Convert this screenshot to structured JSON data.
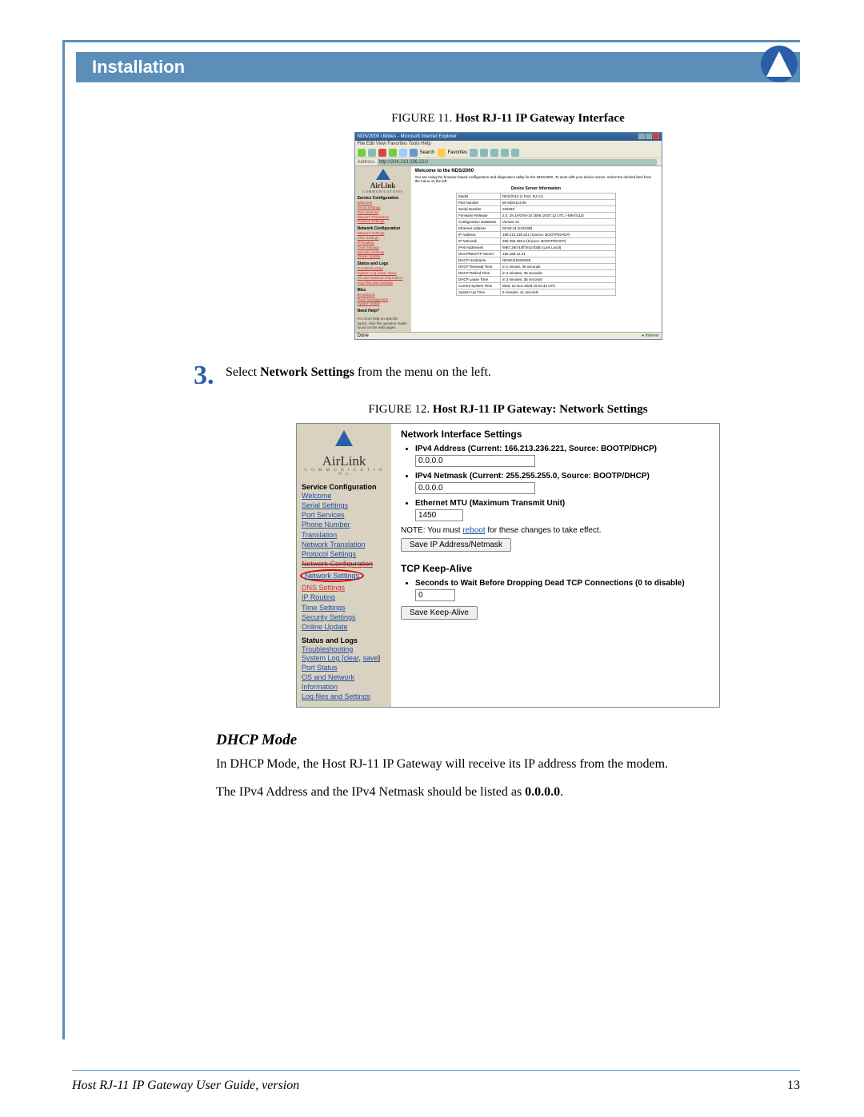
{
  "header": {
    "section": "Installation"
  },
  "fig11": {
    "caption_label": "FIGURE 11.  ",
    "caption_title": "Host RJ-11 IP Gateway Interface",
    "ie": {
      "title": "NDS/2000 Utilities - Microsoft Internet Explorer",
      "menubar": "File  Edit  View  Favorites  Tools  Help",
      "toolbar_search": "Search",
      "toolbar_fav": "Favorites",
      "addr_label": "Address",
      "addr_value": "http://204.213.236.221/",
      "welcome": "Welcome to the NDS/2000",
      "welcome_sub": "You are using the browser-based configuration and diagnostics utility for the NDS/2000. To work with your device server, select the desired item from the menu on the left.",
      "table_heading": "Device Server Information",
      "rows": [
        [
          "Model",
          "NDS/2110 (1 Port, RJ-11)"
        ],
        [
          "Part Number",
          "80-NDS114-00"
        ],
        [
          "Serial Number",
          "019333"
        ],
        [
          "Firmware Release",
          "2.0, 28 JAN'SN-10 2006 19:07:12 UTC (-MN-0113)"
        ],
        [
          "Configuration Database",
          "Version 21"
        ],
        [
          "Ethernet Address",
          "00:60:44:10:83:BB"
        ],
        [
          "IP Address",
          "169.213.236.221 (Source: BOOTP/DHCP)"
        ],
        [
          "IP Netmask",
          "255.255.255.0 (Source: BOOTP/DHCP)"
        ],
        [
          "IPv6 Addresses",
          "fe80::260:44ff:fe10:83bb (Link Local)"
        ],
        [
          "DHCP/BOOTP Server",
          "192.168.12.21"
        ],
        [
          "DHCP Hostname",
          "NDS0119333G88"
        ],
        [
          "DHCP Renewal Time",
          "in 1 minute, 36 seconds"
        ],
        [
          "DHCP Rebind Time",
          "in 2 minutes, 35 seconds"
        ],
        [
          "DHCP Lease Time",
          "in 3 minutes, 35 seconds"
        ],
        [
          "Current System Time",
          "Wed, 22 Nov 2006 19:23:42 UTC"
        ],
        [
          "System Up Time",
          "5 minutes, 41 seconds"
        ]
      ],
      "sidebar": {
        "g1_h": "Service Configuration",
        "g1": [
          "Welcome",
          "Serial Settings",
          "Port Services",
          "Network Translation",
          "Protocol Settings"
        ],
        "g2_h": "Network Configuration",
        "g2": [
          "Network Settings",
          "DNS Settings",
          "IP Routing",
          "Time Settings",
          "Security Settings",
          "Online Update"
        ],
        "g3_h": "Status and Logs",
        "g3": [
          "Troubleshooting",
          "System Log [clear, save]",
          "OS and Network Information",
          "Log Files and Settings"
        ],
        "g4_h": "Misc",
        "g4": [
          "Broadband",
          "Flash Management",
          "System Install"
        ],
        "help_h": "Need Help?",
        "help": "For more help on specific topics, click the question marks found on the web pages.",
        "done": "Done",
        "internet": "Internet"
      }
    }
  },
  "step3": {
    "num": "3.",
    "text_pre": "Select ",
    "text_bold": "Network Settings",
    "text_post": " from the menu on the left."
  },
  "fig12": {
    "caption_label": "FIGURE 12.  ",
    "caption_title": "Host RJ-11 IP Gateway:  Network Settings",
    "sidebar": {
      "logo": "AirLink",
      "logo_sub": "C O M M U N I C A T I O N S",
      "g1_h": "Service Configuration",
      "g1": [
        "Welcome",
        "Serial Settings",
        "Port Services",
        "Phone Number Translation",
        "Network Translation",
        "Protocol Settings"
      ],
      "strike": "Network Configuration",
      "oval": "Network Settings",
      "red_items": [
        "DNS Settings",
        "IP Routing",
        "Time Settings",
        "Security Settings",
        "Online Update"
      ],
      "g3_h": "Status and Logs",
      "g3_a": "Troubleshooting",
      "g3_b_pre": "System Log  [",
      "g3_b_clear": "clear",
      "g3_b_sep": ",  ",
      "g3_b_save": "save",
      "g3_b_post": "]",
      "g3_c": "Port Status",
      "g3_d": "OS and Network Information",
      "g3_e": "Log files and Settings"
    },
    "main": {
      "h1": "Network Interface Settings",
      "li1": "IPv4 Address (Current: 166.213.236.221, Source: BOOTP/DHCP)",
      "v1": "0.0.0.0",
      "li2": "IPv4 Netmask (Current: 255.255.255.0, Source: BOOTP/DHCP)",
      "v2": "0.0.0.0",
      "li3": "Ethernet MTU (Maximum Transmit Unit)",
      "v3": "1450",
      "note_pre": "NOTE: You must ",
      "note_link": "reboot",
      "note_post": " for these changes to take effect.",
      "btn1": "Save IP Address/Netmask",
      "h2": "TCP Keep-Alive",
      "li4": "Seconds to Wait Before Dropping Dead TCP Connections (0 to disable)",
      "v4": "0",
      "btn2": "Save Keep-Alive"
    }
  },
  "body": {
    "h3": "DHCP Mode",
    "p1": "In DHCP Mode, the Host RJ-11 IP Gateway will receive its IP address from the modem.",
    "p2_pre": "The IPv4 Address and the IPv4 Netmask should be listed as ",
    "p2_bold": "0.0.0.0",
    "p2_post": "."
  },
  "footer": {
    "left": "Host RJ-11 IP Gateway User Guide, version",
    "right": "13"
  }
}
